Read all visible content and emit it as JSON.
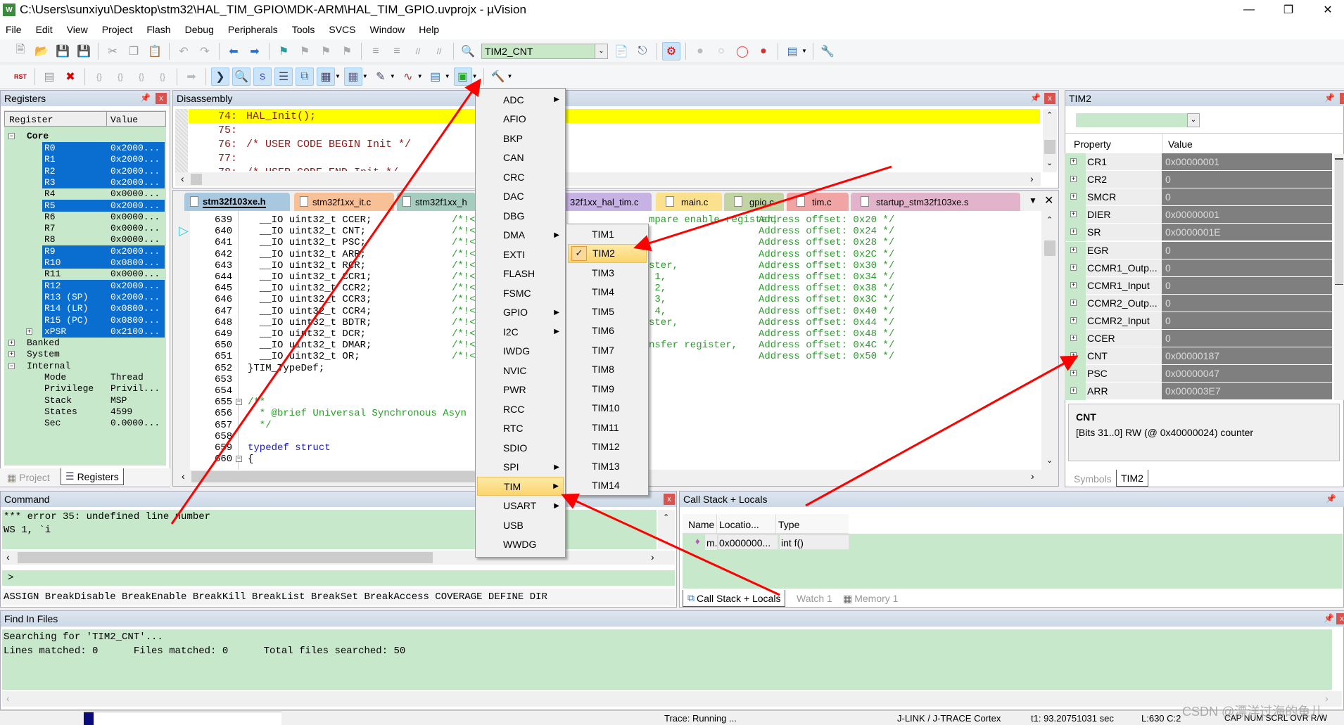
{
  "window": {
    "title": "C:\\Users\\sunxiyu\\Desktop\\stm32\\HAL_TIM_GPIO\\MDK-ARM\\HAL_TIM_GPIO.uvprojx - µVision",
    "app_icon_text": "W"
  },
  "menubar": [
    "File",
    "Edit",
    "View",
    "Project",
    "Flash",
    "Debug",
    "Peripherals",
    "Tools",
    "SVCS",
    "Window",
    "Help"
  ],
  "toolbar1": {
    "items": [
      "new-file",
      "open",
      "save",
      "save-all",
      "|",
      "cut",
      "copy",
      "paste",
      "|",
      "undo",
      "redo",
      "|",
      "nav-back",
      "nav-forward",
      "|",
      "bookmark",
      "bookmark-prev",
      "bookmark-next",
      "bookmark-clear",
      "|",
      "indent",
      "unindent",
      "comment",
      "uncomment",
      "|",
      "find-in-files",
      "COMBO",
      "find",
      "incremental-find",
      "|",
      "debug-session",
      "|",
      "breakpoint",
      "breakpoint-disable",
      "breakpoint-disable-all",
      "breakpoint-kill-all",
      "|",
      "window-layout",
      "|",
      "configure"
    ],
    "find_combo_value": "TIM2_CNT"
  },
  "toolbar2": {
    "items": [
      "reset",
      "|",
      "run",
      "stop",
      "|",
      "step-in",
      "step-over",
      "step-out",
      "run-to-cursor",
      "|",
      "show-next",
      "|",
      "command-window",
      "disassembly-window",
      "symbols-window",
      "registers-window",
      "call-stack-window",
      "watch-window",
      "memory-window",
      "serial-window",
      "analysis-window",
      "trace-window",
      "system-viewer",
      "|",
      "toolbox"
    ],
    "reset_label": "RST"
  },
  "registers": {
    "title": "Registers",
    "col_register": "Register",
    "col_value": "Value",
    "groups": {
      "core": "Core",
      "banked": "Banked",
      "system": "System",
      "internal": "Internal"
    },
    "core": [
      {
        "name": "R0",
        "value": "0x2000...",
        "sel": true
      },
      {
        "name": "R1",
        "value": "0x2000...",
        "sel": true
      },
      {
        "name": "R2",
        "value": "0x2000...",
        "sel": true
      },
      {
        "name": "R3",
        "value": "0x2000...",
        "sel": true
      },
      {
        "name": "R4",
        "value": "0x0000...",
        "sel": false
      },
      {
        "name": "R5",
        "value": "0x2000...",
        "sel": true
      },
      {
        "name": "R6",
        "value": "0x0000...",
        "sel": false
      },
      {
        "name": "R7",
        "value": "0x0000...",
        "sel": false
      },
      {
        "name": "R8",
        "value": "0x0000...",
        "sel": false
      },
      {
        "name": "R9",
        "value": "0x2000...",
        "sel": true
      },
      {
        "name": "R10",
        "value": "0x0800...",
        "sel": true
      },
      {
        "name": "R11",
        "value": "0x0000...",
        "sel": false
      },
      {
        "name": "R12",
        "value": "0x2000...",
        "sel": true
      },
      {
        "name": "R13 (SP)",
        "value": "0x2000...",
        "sel": true
      },
      {
        "name": "R14 (LR)",
        "value": "0x0800...",
        "sel": true
      },
      {
        "name": "R15 (PC)",
        "value": "0x0800...",
        "sel": true
      },
      {
        "name": "xPSR",
        "value": "0x2100...",
        "sel": true
      }
    ],
    "internal": [
      {
        "name": "Mode",
        "value": "Thread"
      },
      {
        "name": "Privilege",
        "value": "Privil..."
      },
      {
        "name": "Stack",
        "value": "MSP"
      },
      {
        "name": "States",
        "value": "4599"
      },
      {
        "name": "Sec",
        "value": "0.0000..."
      }
    ],
    "tabs": [
      "Project",
      "Registers"
    ]
  },
  "disassembly": {
    "title": "Disassembly",
    "lines": [
      {
        "num": "74:",
        "code": "HAL_Init();",
        "current": true
      },
      {
        "num": "75:",
        "code": ""
      },
      {
        "num": "76:",
        "code": "/* USER CODE BEGIN Init */"
      },
      {
        "num": "77:",
        "code": ""
      },
      {
        "num": "78:",
        "code": "/* USER CODE END Init */"
      }
    ]
  },
  "editor": {
    "tabs": [
      {
        "label": "stm32f103xe.h",
        "color": "#a8c8e0",
        "active": true
      },
      {
        "label": "stm32f1xx_it.c",
        "color": "#f8c096"
      },
      {
        "label": "stm32f1xx_h",
        "color": "#a6ccbf"
      },
      {
        "label": "32f1xx_hal_tim.c",
        "color": "#c7b3e3"
      },
      {
        "label": "main.c",
        "color": "#fbe08e"
      },
      {
        "label": "gpio.c",
        "color": "#c2d4a4"
      },
      {
        "label": "tim.c",
        "color": "#f0a4a4"
      },
      {
        "label": "startup_stm32f103xe.s",
        "color": "#e2b4cc"
      }
    ],
    "lines": [
      {
        "num": "639",
        "code": "  __IO uint32_t CCER;",
        "cm": "/*!<",
        "tail": "mpare enable register,",
        "ad": "Address offset: 0x20 */"
      },
      {
        "num": "640",
        "code": "  __IO uint32_t CNT;",
        "cm": "/*!<",
        "tail": "",
        "ad": "Address offset: 0x24 */"
      },
      {
        "num": "641",
        "code": "  __IO uint32_t PSC;",
        "cm": "/*!<",
        "tail": "",
        "ad": "Address offset: 0x28 */"
      },
      {
        "num": "642",
        "code": "  __IO uint32_t ARR;",
        "cm": "/*!<",
        "tail": "",
        "ad": "Address offset: 0x2C */"
      },
      {
        "num": "643",
        "code": "  __IO uint32_t RCR;",
        "cm": "/*!<",
        "tail": "ster,",
        "ad": "Address offset: 0x30 */"
      },
      {
        "num": "644",
        "code": "  __IO uint32_t CCR1;",
        "cm": "/*!<",
        "tail": " 1,",
        "ad": "Address offset: 0x34 */"
      },
      {
        "num": "645",
        "code": "  __IO uint32_t CCR2;",
        "cm": "/*!<",
        "tail": " 2,",
        "ad": "Address offset: 0x38 */"
      },
      {
        "num": "646",
        "code": "  __IO uint32_t CCR3;",
        "cm": "/*!<",
        "tail": " 3,",
        "ad": "Address offset: 0x3C */"
      },
      {
        "num": "647",
        "code": "  __IO uint32_t CCR4;",
        "cm": "/*!<",
        "tail": " 4,",
        "ad": "Address offset: 0x40 */"
      },
      {
        "num": "648",
        "code": "  __IO uint32_t BDTR;",
        "cm": "/*!<",
        "tail": "ster,",
        "ad": "Address offset: 0x44 */"
      },
      {
        "num": "649",
        "code": "  __IO uint32_t DCR;",
        "cm": "/*!<",
        "tail": "",
        "ad": "Address offset: 0x48 */"
      },
      {
        "num": "650",
        "code": "  __IO uint32_t DMAR;",
        "cm": "/*!<",
        "tail": "nsfer register,",
        "ad": "Address offset: 0x4C */"
      },
      {
        "num": "651",
        "code": "  __IO uint32_t OR;",
        "cm": "/*!<",
        "tail": "",
        "ad": "Address offset: 0x50 */"
      },
      {
        "num": "652",
        "code": "}TIM_TypeDef;",
        "cm": "",
        "tail": "",
        "ad": ""
      },
      {
        "num": "653",
        "code": "",
        "cm": "",
        "tail": "",
        "ad": ""
      },
      {
        "num": "654",
        "code": "",
        "cm": "",
        "tail": "",
        "ad": ""
      },
      {
        "num": "655",
        "code": "/**",
        "cm": "",
        "tail": "",
        "ad": "",
        "kind": "comment"
      },
      {
        "num": "656",
        "code": "  * @brief Universal Synchronous Asyn",
        "cm": "",
        "tail": "",
        "ad": "",
        "kind": "comment"
      },
      {
        "num": "657",
        "code": "  */",
        "cm": "",
        "tail": "",
        "ad": "",
        "kind": "comment"
      },
      {
        "num": "658",
        "code": "",
        "cm": "",
        "tail": "",
        "ad": ""
      },
      {
        "num": "659",
        "code": "typedef struct",
        "cm": "",
        "tail": "",
        "ad": "",
        "kind": "keyword"
      },
      {
        "num": "660",
        "code": "{",
        "cm": "",
        "tail": "",
        "ad": ""
      }
    ]
  },
  "peripherals_menu": {
    "items": [
      {
        "label": "ADC",
        "sub": true
      },
      {
        "label": "AFIO"
      },
      {
        "label": "BKP"
      },
      {
        "label": "CAN"
      },
      {
        "label": "CRC"
      },
      {
        "label": "DAC"
      },
      {
        "label": "DBG"
      },
      {
        "label": "DMA",
        "sub": true
      },
      {
        "label": "EXTI"
      },
      {
        "label": "FLASH"
      },
      {
        "label": "FSMC"
      },
      {
        "label": "GPIO",
        "sub": true
      },
      {
        "label": "I2C",
        "sub": true
      },
      {
        "label": "IWDG"
      },
      {
        "label": "NVIC"
      },
      {
        "label": "PWR"
      },
      {
        "label": "RCC"
      },
      {
        "label": "RTC"
      },
      {
        "label": "SDIO"
      },
      {
        "label": "SPI",
        "sub": true
      },
      {
        "label": "TIM",
        "sub": true,
        "hl": true
      },
      {
        "label": "USART",
        "sub": true
      },
      {
        "label": "USB"
      },
      {
        "label": "WWDG"
      }
    ],
    "tim_submenu": [
      {
        "label": "TIM1"
      },
      {
        "label": "TIM2",
        "checked": true,
        "hl": true
      },
      {
        "label": "TIM3"
      },
      {
        "label": "TIM4"
      },
      {
        "label": "TIM5"
      },
      {
        "label": "TIM6"
      },
      {
        "label": "TIM7"
      },
      {
        "label": "TIM8"
      },
      {
        "label": "TIM9"
      },
      {
        "label": "TIM10"
      },
      {
        "label": "TIM11"
      },
      {
        "label": "TIM12"
      },
      {
        "label": "TIM13"
      },
      {
        "label": "TIM14"
      }
    ]
  },
  "tim2_panel": {
    "title": "TIM2",
    "col_property": "Property",
    "col_value": "Value",
    "rows": [
      {
        "name": "CR1",
        "value": "0x00000001"
      },
      {
        "name": "CR2",
        "value": "0"
      },
      {
        "name": "SMCR",
        "value": "0"
      },
      {
        "name": "DIER",
        "value": "0x00000001"
      },
      {
        "name": "SR",
        "value": "0x0000001E"
      },
      {
        "name": "EGR",
        "value": "0"
      },
      {
        "name": "CCMR1_Outp...",
        "value": "0"
      },
      {
        "name": "CCMR1_Input",
        "value": "0"
      },
      {
        "name": "CCMR2_Outp...",
        "value": "0"
      },
      {
        "name": "CCMR2_Input",
        "value": "0"
      },
      {
        "name": "CCER",
        "value": "0"
      },
      {
        "name": "CNT",
        "value": "0x00000187"
      },
      {
        "name": "PSC",
        "value": "0x00000047"
      },
      {
        "name": "ARR",
        "value": "0x000003E7"
      }
    ],
    "desc_title": "CNT",
    "desc_text": "[Bits 31..0] RW (@ 0x40000024) counter",
    "tabs": [
      "Symbols",
      "TIM2"
    ]
  },
  "command": {
    "title": "Command",
    "output": [
      "*** error 35: undefined line number",
      "WS 1, `i"
    ],
    "prompt": ">",
    "hint": "ASSIGN BreakDisable BreakEnable BreakKill BreakList BreakSet BreakAccess COVERAGE DEFINE DIR"
  },
  "callstack": {
    "title": "Call Stack + Locals",
    "cols": [
      "Name",
      "Locatio...",
      "Type"
    ],
    "row": {
      "name": "m...",
      "location": "0x000000...",
      "type": "int f()"
    },
    "tabs": [
      "Call Stack + Locals",
      "Watch 1",
      "Memory 1"
    ]
  },
  "find_in_files": {
    "title": "Find In Files",
    "lines": [
      "Searching for 'TIM2_CNT'...",
      "Lines matched: 0      Files matched: 0      Total files searched: 50"
    ]
  },
  "statusbar": {
    "progress_percent": 5,
    "trace": "Trace: Running ...",
    "debugger": "J-LINK / J-TRACE Cortex",
    "time": "t1: 93.20751031 sec",
    "position": "L:630 C:2",
    "indicators": "CAP NUM SCRL OVR R/W"
  },
  "watermark": "CSDN @漂洋过海的鱼儿",
  "colors": {
    "pane_green": "#c8e8cc",
    "selection": "#0a6ed1",
    "current_line": "#ffff00",
    "annotation_arrow": "#ff0000",
    "menu_highlight": "#fbd56c"
  }
}
